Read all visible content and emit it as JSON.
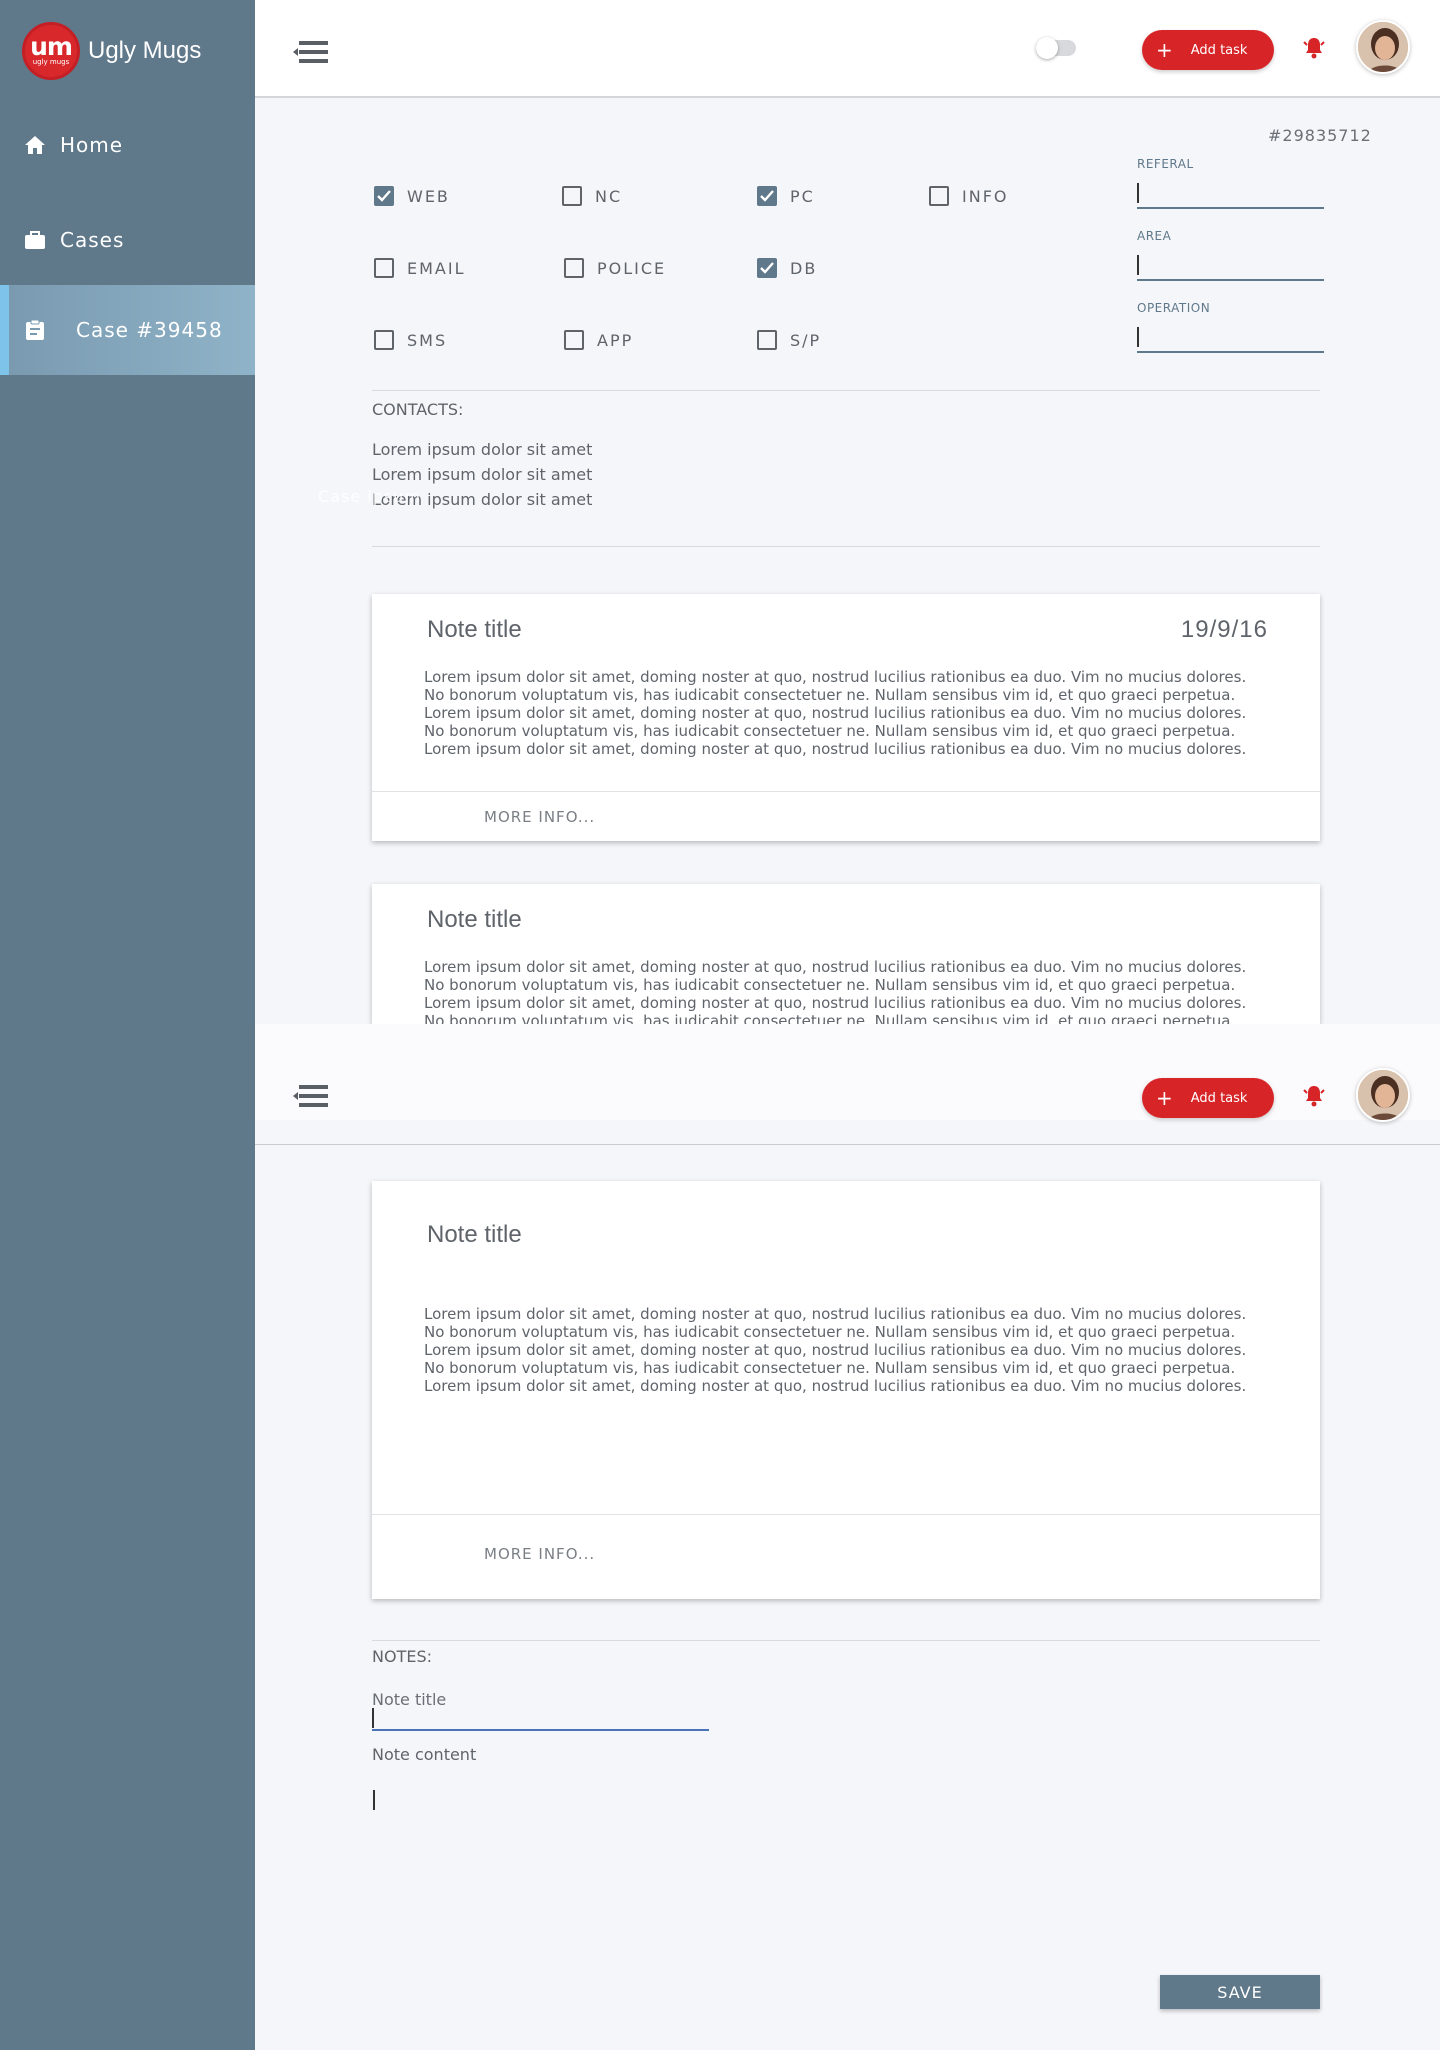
{
  "brand": {
    "logo_text": "um",
    "logo_subtext": "ugly mugs",
    "name": "Ugly Mugs"
  },
  "sidebar": {
    "items": [
      {
        "label": "Home",
        "icon": "home-icon"
      },
      {
        "label": "Cases",
        "icon": "briefcase-icon"
      },
      {
        "label": "Case #39458",
        "icon": "clipboard-icon",
        "active": true
      }
    ]
  },
  "header": {
    "add_task_label": "Add task",
    "toggle_on": false
  },
  "case": {
    "id": "#29835712",
    "checkboxes": [
      {
        "label": "WEB",
        "checked": true
      },
      {
        "label": "NC",
        "checked": false
      },
      {
        "label": "PC",
        "checked": true
      },
      {
        "label": "INFO",
        "checked": false
      },
      {
        "label": "EMAIL",
        "checked": false
      },
      {
        "label": "POLICE",
        "checked": false
      },
      {
        "label": "DB",
        "checked": true
      },
      {
        "label": "SMS",
        "checked": false
      },
      {
        "label": "APP",
        "checked": false
      },
      {
        "label": "S/P",
        "checked": false
      }
    ],
    "fields": [
      {
        "label": "REFERAL",
        "value": ""
      },
      {
        "label": "AREA",
        "value": ""
      },
      {
        "label": "OPERATION",
        "value": ""
      }
    ],
    "contacts_label": "CONTACTS:",
    "contacts": [
      "Lorem ipsum dolor sit amet",
      "Lorem ipsum dolor sit amet",
      "Lorem ipsum dolor sit amet"
    ],
    "ghost_text": "Case ipsum"
  },
  "notes": [
    {
      "title": "Note title",
      "date": "19/9/16",
      "lines": [
        "Lorem ipsum dolor sit amet, doming noster at quo, nostrud lucilius rationibus ea duo. Vim no mucius dolores.",
        "No bonorum voluptatum vis, has iudicabit consectetuer ne. Nullam sensibus vim id, et quo graeci perpetua.",
        "Lorem ipsum dolor sit amet, doming noster at quo, nostrud lucilius rationibus ea duo. Vim no mucius dolores.",
        "No bonorum voluptatum vis, has iudicabit consectetuer ne. Nullam sensibus vim id, et quo graeci perpetua.",
        "Lorem ipsum dolor sit amet, doming noster at quo, nostrud lucilius rationibus ea duo. Vim no mucius dolores."
      ],
      "more": "MORE INFO..."
    },
    {
      "title": "Note title",
      "lines": [
        "Lorem ipsum dolor sit amet, doming noster at quo, nostrud lucilius rationibus ea duo. Vim no mucius dolores.",
        "No bonorum voluptatum vis, has iudicabit consectetuer ne. Nullam sensibus vim id, et quo graeci perpetua.",
        "Lorem ipsum dolor sit amet, doming noster at quo, nostrud lucilius rationibus ea duo. Vim no mucius dolores.",
        "No bonorum voluptatum vis, has iudicabit consectetuer ne. Nullam sensibus vim id, et quo graeci perpetua."
      ]
    },
    {
      "title": "Note title",
      "lines": [
        "Lorem ipsum dolor sit amet, doming noster at quo, nostrud lucilius rationibus ea duo. Vim no mucius dolores.",
        "No bonorum voluptatum vis, has iudicabit consectetuer ne. Nullam sensibus vim id, et quo graeci perpetua.",
        "Lorem ipsum dolor sit amet, doming noster at quo, nostrud lucilius rationibus ea duo. Vim no mucius dolores.",
        "No bonorum voluptatum vis, has iudicabit consectetuer ne. Nullam sensibus vim id, et quo graeci perpetua.",
        "Lorem ipsum dolor sit amet, doming noster at quo, nostrud lucilius rationibus ea duo. Vim no mucius dolores."
      ],
      "more": "MORE INFO..."
    }
  ],
  "editor": {
    "notes_label": "NOTES:",
    "title_placeholder": "Note title",
    "content_label": "Note content",
    "save_label": "SAVE"
  },
  "colors": {
    "sidebar": "#5f788a",
    "accent_red": "#d72427",
    "active_marker": "#7ec3ea",
    "input_focus": "#4a72b8"
  }
}
